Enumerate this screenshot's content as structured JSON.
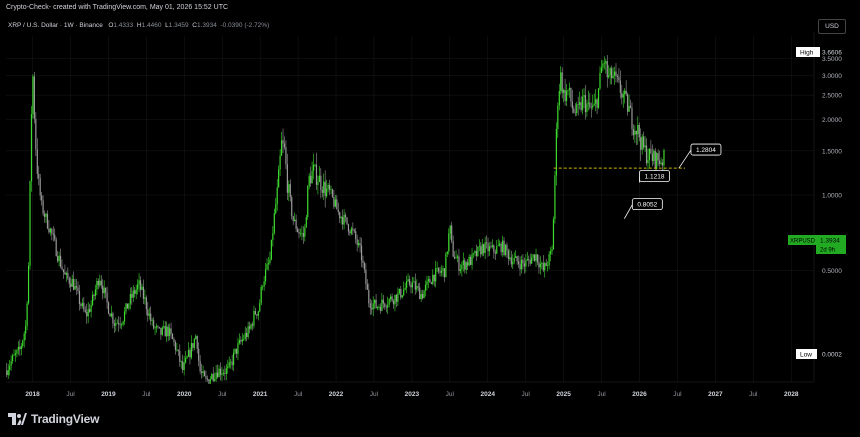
{
  "header": {
    "attribution": "Crypto-Check- created with TradingView.com, May 01, 2026 15:52 UTC"
  },
  "symbol": {
    "name": "XRP / U.S. Dollar · 1W · Binance",
    "o_label": "O",
    "o_value": "1.4333",
    "h_label": "H",
    "h_value": "1.4460",
    "l_label": "L",
    "l_value": "1.3459",
    "c_label": "C",
    "c_value": "1.3934",
    "change": "-0.0390 (-2.72%)"
  },
  "currency_button": "USD",
  "brand": "TradingView",
  "colors": {
    "background": "#000000",
    "candle_up": "#3ddc2e",
    "candle_down": "#9a9a9a",
    "last_price_badge": "#22ab22",
    "dashed_line": "#c8b400",
    "grid": "#1a1a1a"
  },
  "chart_data": {
    "type": "candlestick",
    "title": "XRP / U.S. Dollar · 1W · Binance",
    "y_scale": "log",
    "ylim": [
      0.18,
      4.3
    ],
    "y_ticks": [
      "3.5000",
      "3.0000",
      "2.5000",
      "2.0000",
      "1.5000",
      "1.0000",
      "0.5000"
    ],
    "y_tick_values": [
      3.5,
      3.0,
      2.5,
      2.0,
      1.5,
      1.0,
      0.5
    ],
    "x_ticks": [
      "2018",
      "Jul",
      "2019",
      "Jul",
      "2020",
      "Jul",
      "2021",
      "Jul",
      "2022",
      "Jul",
      "2023",
      "Jul",
      "2024",
      "Jul",
      "2025",
      "Jul",
      "2026",
      "Jul",
      "2027",
      "Jul",
      "2028"
    ],
    "x_tick_values": [
      2018.0,
      2018.5,
      2019.0,
      2019.5,
      2020.0,
      2020.5,
      2021.0,
      2021.5,
      2022.0,
      2022.5,
      2023.0,
      2023.5,
      2024.0,
      2024.5,
      2025.0,
      2025.5,
      2026.0,
      2026.5,
      2027.0,
      2027.5,
      2028.0
    ],
    "xlim": [
      2017.65,
      2028.3
    ],
    "high_label": "High",
    "high_value": "3.6606",
    "low_label": "Low",
    "low_value": "0.0002",
    "last_symbol": "XRPUSD",
    "last_price": "1.3934",
    "last_countdown": "2d 9h",
    "dashed_level": 1.28,
    "dashed_from": 2024.87,
    "annotations": [
      {
        "label": "1.2804",
        "x": 2026.52,
        "y": 1.2804
      },
      {
        "label": "1.1218",
        "x": 2026.0,
        "y": 1.1218
      },
      {
        "label": "0.8052",
        "x": 2025.8,
        "y": 0.8052
      }
    ],
    "series": [
      {
        "x": [
          2017.66,
          2017.75,
          2017.85,
          2017.93,
          2017.97,
          2018.0,
          2018.02,
          2018.04,
          2018.07,
          2018.1,
          2018.14,
          2018.2,
          2018.27,
          2018.35,
          2018.45,
          2018.55,
          2018.65,
          2018.72,
          2018.8,
          2018.9,
          2019.0,
          2019.1,
          2019.2,
          2019.3,
          2019.42,
          2019.5,
          2019.6,
          2019.7,
          2019.8,
          2019.9,
          2020.0,
          2020.1,
          2020.18,
          2020.22,
          2020.3,
          2020.45,
          2020.6,
          2020.7,
          2020.8,
          2020.88,
          2020.95,
          2021.0,
          2021.05,
          2021.1,
          2021.15,
          2021.2,
          2021.25,
          2021.3,
          2021.34,
          2021.38,
          2021.45,
          2021.52,
          2021.6,
          2021.66,
          2021.72,
          2021.8,
          2021.88,
          2021.95,
          2022.05,
          2022.15,
          2022.25,
          2022.35,
          2022.45,
          2022.55,
          2022.7,
          2022.85,
          2023.0,
          2023.15,
          2023.3,
          2023.45,
          2023.52,
          2023.55,
          2023.65,
          2023.8,
          2023.95,
          2024.1,
          2024.2,
          2024.35,
          2024.5,
          2024.65,
          2024.75,
          2024.82,
          2024.87,
          2024.9,
          2024.94,
          2024.98,
          2025.02,
          2025.08,
          2025.14,
          2025.2,
          2025.28,
          2025.35,
          2025.42,
          2025.47,
          2025.52,
          2025.56,
          2025.6,
          2025.66,
          2025.72,
          2025.8,
          2025.88,
          2025.94,
          2026.0,
          2026.06,
          2026.12,
          2026.2,
          2026.28,
          2026.33
        ],
        "y": [
          0.2,
          0.22,
          0.24,
          0.3,
          0.55,
          1.9,
          3.2,
          2.2,
          1.4,
          1.1,
          0.9,
          0.8,
          0.7,
          0.58,
          0.47,
          0.45,
          0.37,
          0.33,
          0.37,
          0.48,
          0.37,
          0.31,
          0.32,
          0.38,
          0.44,
          0.38,
          0.3,
          0.28,
          0.29,
          0.25,
          0.2,
          0.24,
          0.28,
          0.2,
          0.18,
          0.2,
          0.2,
          0.24,
          0.27,
          0.29,
          0.34,
          0.35,
          0.45,
          0.5,
          0.55,
          0.8,
          1.05,
          1.6,
          1.5,
          1.1,
          0.8,
          0.72,
          0.68,
          1.15,
          1.25,
          1.15,
          1.05,
          1.0,
          0.85,
          0.78,
          0.7,
          0.58,
          0.38,
          0.36,
          0.38,
          0.4,
          0.45,
          0.4,
          0.48,
          0.5,
          0.75,
          0.6,
          0.52,
          0.55,
          0.62,
          0.6,
          0.63,
          0.55,
          0.53,
          0.58,
          0.5,
          0.55,
          0.6,
          1.1,
          2.4,
          3.0,
          2.5,
          2.6,
          2.2,
          2.1,
          2.4,
          2.2,
          2.2,
          2.5,
          3.2,
          3.45,
          2.9,
          3.0,
          2.8,
          2.5,
          2.2,
          1.9,
          1.8,
          1.55,
          1.45,
          1.4,
          1.38,
          1.39
        ]
      }
    ]
  }
}
